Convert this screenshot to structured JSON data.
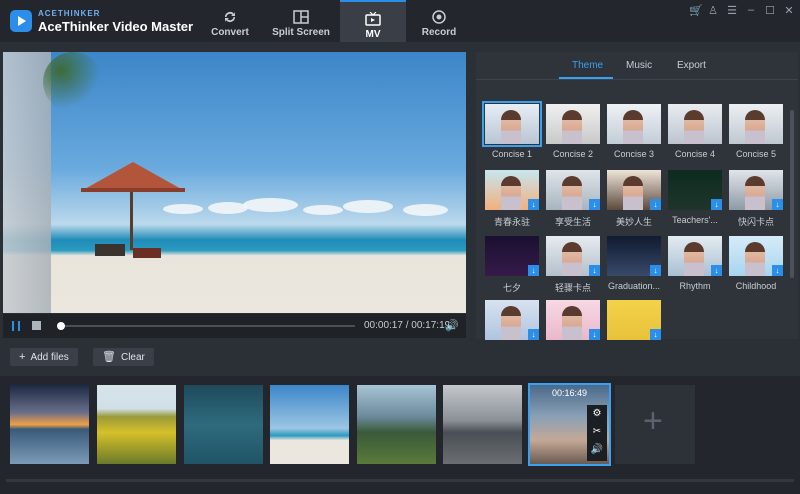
{
  "app": {
    "brand_small": "ACETHINKER",
    "title": "AceThinker Video Master",
    "accent": "#2b8ee8"
  },
  "nav": [
    {
      "label": "Convert",
      "icon": "refresh-icon"
    },
    {
      "label": "Split Screen",
      "icon": "split-screen-icon"
    },
    {
      "label": "MV",
      "icon": "tv-icon",
      "active": true
    },
    {
      "label": "Record",
      "icon": "record-icon"
    }
  ],
  "window_icons": [
    "cart-icon",
    "user-icon",
    "menu-icon",
    "minimize-icon",
    "maximize-icon",
    "close-icon"
  ],
  "player": {
    "current_time": "00:00:17",
    "separator": "/",
    "total_time": "00:17:19",
    "progress": 0.017
  },
  "right_panel": {
    "tabs": [
      "Theme",
      "Music",
      "Export"
    ],
    "active_tab": "Theme",
    "themes": [
      {
        "name": "Concise 1",
        "selected": true
      },
      {
        "name": "Concise 2"
      },
      {
        "name": "Concise 3"
      },
      {
        "name": "Concise 4"
      },
      {
        "name": "Concise 5"
      },
      {
        "name": "青春永驻"
      },
      {
        "name": "享受生活"
      },
      {
        "name": "美妙人生"
      },
      {
        "name": "Teachers'..."
      },
      {
        "name": "快闪卡点"
      },
      {
        "name": "七夕"
      },
      {
        "name": "轻骤卡点"
      },
      {
        "name": "Graduation..."
      },
      {
        "name": "Rhythm"
      },
      {
        "name": "Childhood"
      },
      {
        "name": ""
      },
      {
        "name": ""
      },
      {
        "name": ""
      }
    ]
  },
  "toolbar": {
    "add_files": "Add files",
    "clear": "Clear"
  },
  "clips": [
    {
      "scene": "sunset-lake"
    },
    {
      "scene": "sunflowers"
    },
    {
      "scene": "boat-sea"
    },
    {
      "scene": "beach-umbrella"
    },
    {
      "scene": "temple-field"
    },
    {
      "scene": "road-house"
    },
    {
      "scene": "phone-hand",
      "duration": "00:16:49",
      "active": true
    }
  ]
}
